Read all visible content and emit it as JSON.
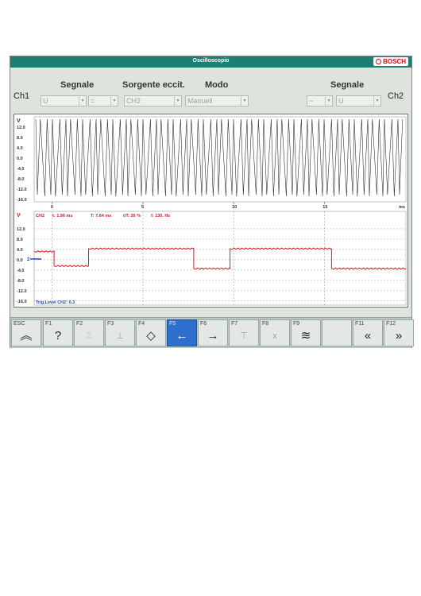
{
  "window": {
    "title": "Oscilloscopio",
    "brand": "BOSCH"
  },
  "controls": {
    "ch1_label": "Ch1",
    "ch2_label": "Ch2",
    "segnale_left_label": "Segnale",
    "sorgente_label": "Sorgente eccit.",
    "modo_label": "Modo",
    "segnale_right_label": "Segnale",
    "ch1_signal_value": "U",
    "ch1_coupling_value": "=",
    "source_value": "CH2",
    "mode_value": "Manuell",
    "ch2_coupling_value": "~",
    "ch2_signal_value": "U"
  },
  "plot1": {
    "unit_label": "V",
    "y_ticks": [
      "12.0",
      "8.0",
      "4.0",
      "0.0",
      "-4.0",
      "-8.0",
      "-12.0",
      "-16.0"
    ],
    "x_ticks": [
      "0",
      "5",
      "10",
      "15"
    ],
    "x_unit": "ms"
  },
  "plot2": {
    "unit_label": "V",
    "y_ticks": [
      "12.0",
      "8.0",
      "4.0",
      "0.0",
      "-4.0",
      "-8.0",
      "-12.0",
      "-16.0"
    ],
    "measurements": {
      "channel": "CH2",
      "t": "t: 1.96 ms",
      "period": "T: 7.64 ms",
      "duty": "t/T: 26 %",
      "freq": "f: 130. Hz"
    },
    "trigger_text": "Trig.Level CH2: 0.3",
    "trigger_marker": "2"
  },
  "chart_data": {
    "type": "line",
    "xlabel": "ms",
    "ylabel": "V",
    "xlim": [
      -1,
      19.5
    ],
    "ylim": [
      -17,
      16
    ],
    "grid": true,
    "series": [
      {
        "name": "CH2",
        "color": "#d42020",
        "x": [
          -1,
          0.1,
          0.1,
          2,
          2,
          7.8,
          7.8,
          9.8,
          9.8,
          15.4,
          15.4,
          19.5
        ],
        "y": [
          3.2,
          3.2,
          -2.4,
          -2.4,
          4.3,
          4.3,
          -3.4,
          -3.4,
          4.3,
          4.3,
          -3.4,
          -3.4
        ]
      }
    ]
  },
  "function_keys": [
    {
      "key": "ESC",
      "icon": "double-up-chevron-icon",
      "glyph": "︽",
      "active": false
    },
    {
      "key": "F1",
      "icon": "help-person-icon",
      "glyph": "?",
      "active": false
    },
    {
      "key": "F2",
      "icon": "signal-edge-icon",
      "glyph": "⎍",
      "active": false
    },
    {
      "key": "F3",
      "icon": "trigger-icon",
      "glyph": "⊥",
      "active": false
    },
    {
      "key": "F4",
      "icon": "diamond-icon",
      "glyph": "◇",
      "active": false
    },
    {
      "key": "F5",
      "icon": "arrow-left-icon",
      "glyph": "←",
      "active": true
    },
    {
      "key": "F6",
      "icon": "arrow-right-icon",
      "glyph": "→",
      "active": false
    },
    {
      "key": "F7",
      "icon": "cursor-icon",
      "glyph": "⊤",
      "active": false
    },
    {
      "key": "F8",
      "icon": "x-cursor-icon",
      "glyph": "x",
      "active": false
    },
    {
      "key": "F9",
      "icon": "waveform-icon",
      "glyph": "≋",
      "active": false
    },
    {
      "key": "",
      "icon": "",
      "glyph": "",
      "active": false
    },
    {
      "key": "F11",
      "icon": "double-left-chevron-icon",
      "glyph": "«",
      "active": false
    },
    {
      "key": "F12",
      "icon": "double-right-chevron-icon",
      "glyph": "»",
      "active": false
    }
  ]
}
